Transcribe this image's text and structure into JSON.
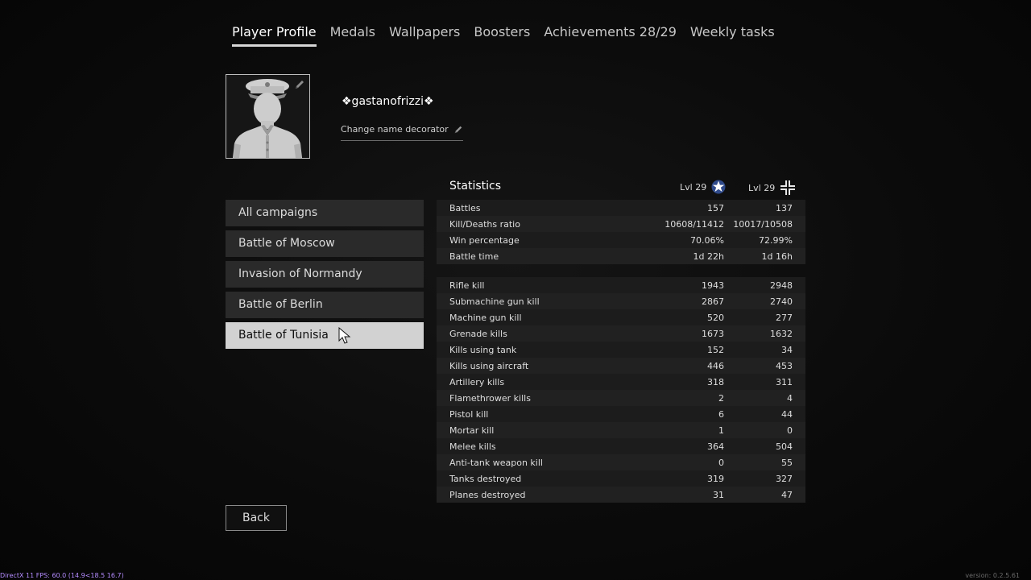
{
  "tabs": [
    {
      "label": "Player Profile"
    },
    {
      "label": "Medals"
    },
    {
      "label": "Wallpapers"
    },
    {
      "label": "Boosters"
    },
    {
      "label": "Achievements 28/29"
    },
    {
      "label": "Weekly tasks"
    }
  ],
  "profile": {
    "name": "❖gastanofrizzi❖",
    "change_name_label": "Change name decorator",
    "avatar_icon": "officer-portrait",
    "edit_icon": "pencil-icon"
  },
  "campaigns": [
    {
      "label": "All campaigns"
    },
    {
      "label": "Battle of Moscow"
    },
    {
      "label": "Invasion of Normandy"
    },
    {
      "label": "Battle of Berlin"
    },
    {
      "label": "Battle of Tunisia"
    }
  ],
  "selected_campaign": "Battle of Tunisia",
  "back_label": "Back",
  "statistics": {
    "title": "Statistics",
    "allies_level": "Lvl 29",
    "axis_level": "Lvl 29",
    "summary": [
      {
        "label": "Battles",
        "allies": "157",
        "axis": "137"
      },
      {
        "label": "Kill/Deaths ratio",
        "allies": "10608/11412",
        "axis": "10017/10508"
      },
      {
        "label": "Win percentage",
        "allies": "70.06%",
        "axis": "72.99%"
      },
      {
        "label": "Battle time",
        "allies": "1d 22h",
        "axis": "1d 16h"
      }
    ],
    "kills": [
      {
        "label": "Rifle kill",
        "allies": "1943",
        "axis": "2948"
      },
      {
        "label": "Submachine gun kill",
        "allies": "2867",
        "axis": "2740"
      },
      {
        "label": "Machine gun kill",
        "allies": "520",
        "axis": "277"
      },
      {
        "label": "Grenade kills",
        "allies": "1673",
        "axis": "1632"
      },
      {
        "label": "Kills using tank",
        "allies": "152",
        "axis": "34"
      },
      {
        "label": "Kills using aircraft",
        "allies": "446",
        "axis": "453"
      },
      {
        "label": "Artillery kills",
        "allies": "318",
        "axis": "311"
      },
      {
        "label": "Flamethrower kills",
        "allies": "2",
        "axis": "4"
      },
      {
        "label": "Pistol kill",
        "allies": "6",
        "axis": "44"
      },
      {
        "label": "Mortar kill",
        "allies": "1",
        "axis": "0"
      },
      {
        "label": "Melee kills",
        "allies": "364",
        "axis": "504"
      },
      {
        "label": "Anti-tank weapon kill",
        "allies": "0",
        "axis": "55"
      },
      {
        "label": "Tanks destroyed",
        "allies": "319",
        "axis": "327"
      },
      {
        "label": "Planes destroyed",
        "allies": "31",
        "axis": "47"
      }
    ]
  },
  "debug": {
    "fps_text": "DirectX 11 FPS: 60.0 (14.9<18.5 16.7)",
    "version_text": "version: 0.2.5.61"
  },
  "colors": {
    "active_tab_underline": "#d6d6d6",
    "selected_campaign_bg": "#d2d2d2",
    "fps_text": "#b48cff"
  }
}
